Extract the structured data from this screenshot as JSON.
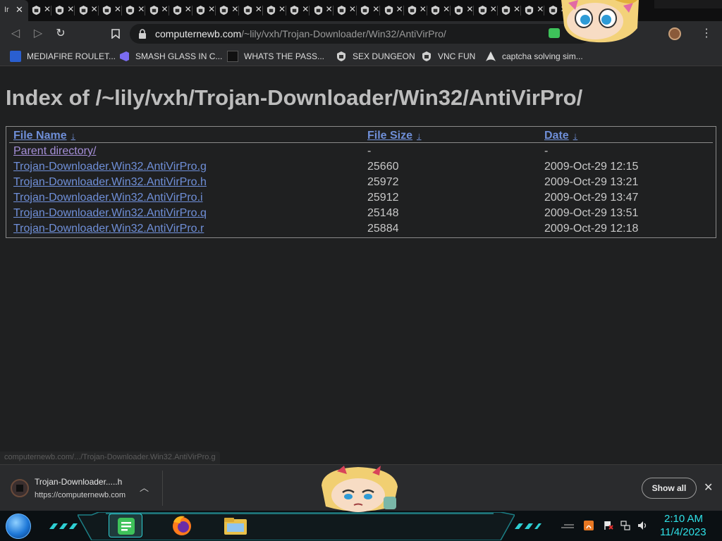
{
  "browser": {
    "active_tab_title": "Ir",
    "pinned_tab_count": 23,
    "url_host": "computernewb.com",
    "url_path": "/~lily/vxh/Trojan-Downloader/Win32/AntiVirPro/",
    "bookmarks": [
      {
        "label": "MEDIAFIRE ROULET...",
        "icon": "mediafire-icon"
      },
      {
        "label": "SMASH GLASS IN C...",
        "icon": "visual-studio-icon"
      },
      {
        "label": "WHATS THE PASS...",
        "icon": "terminal-icon"
      },
      {
        "label": "SEX DUNGEON",
        "icon": "shield-icon"
      },
      {
        "label": "VNC FUN",
        "icon": "shield-icon"
      },
      {
        "label": "captcha solving sim...",
        "icon": "arch-icon"
      }
    ]
  },
  "page": {
    "heading": "Index of /~lily/vxh/Trojan-Downloader/Win32/AntiVirPro/",
    "columns": {
      "name": "File Name",
      "size": "File Size",
      "date": "Date",
      "sort_arrow": "↓"
    },
    "rows": [
      {
        "name": "Parent directory/",
        "size": "-",
        "date": "-"
      },
      {
        "name": "Trojan-Downloader.Win32.AntiVirPro.g",
        "size": "25660",
        "date": "2009-Oct-29 12:15"
      },
      {
        "name": "Trojan-Downloader.Win32.AntiVirPro.h",
        "size": "25972",
        "date": "2009-Oct-29 13:21"
      },
      {
        "name": "Trojan-Downloader.Win32.AntiVirPro.i",
        "size": "25912",
        "date": "2009-Oct-29 13:47"
      },
      {
        "name": "Trojan-Downloader.Win32.AntiVirPro.q",
        "size": "25148",
        "date": "2009-Oct-29 13:51"
      },
      {
        "name": "Trojan-Downloader.Win32.AntiVirPro.r",
        "size": "25884",
        "date": "2009-Oct-29 12:18"
      }
    ],
    "status_url": "computernewb.com/.../Trojan-Downloader.Win32.AntiVirPro.g"
  },
  "downloads": {
    "item_name": "Trojan-Downloader.....h",
    "item_source": "https://computernewb.com",
    "show_all_label": "Show all"
  },
  "taskbar": {
    "time": "2:10 AM",
    "date": "11/4/2023",
    "apps": [
      "sheets-icon",
      "firefox-icon",
      "file-explorer-icon"
    ]
  },
  "colors": {
    "link": "#6f8fd8",
    "visited_link": "#a58fd8",
    "clock": "#2ee0e6",
    "taskbar_accent": "#2ecfd3"
  }
}
